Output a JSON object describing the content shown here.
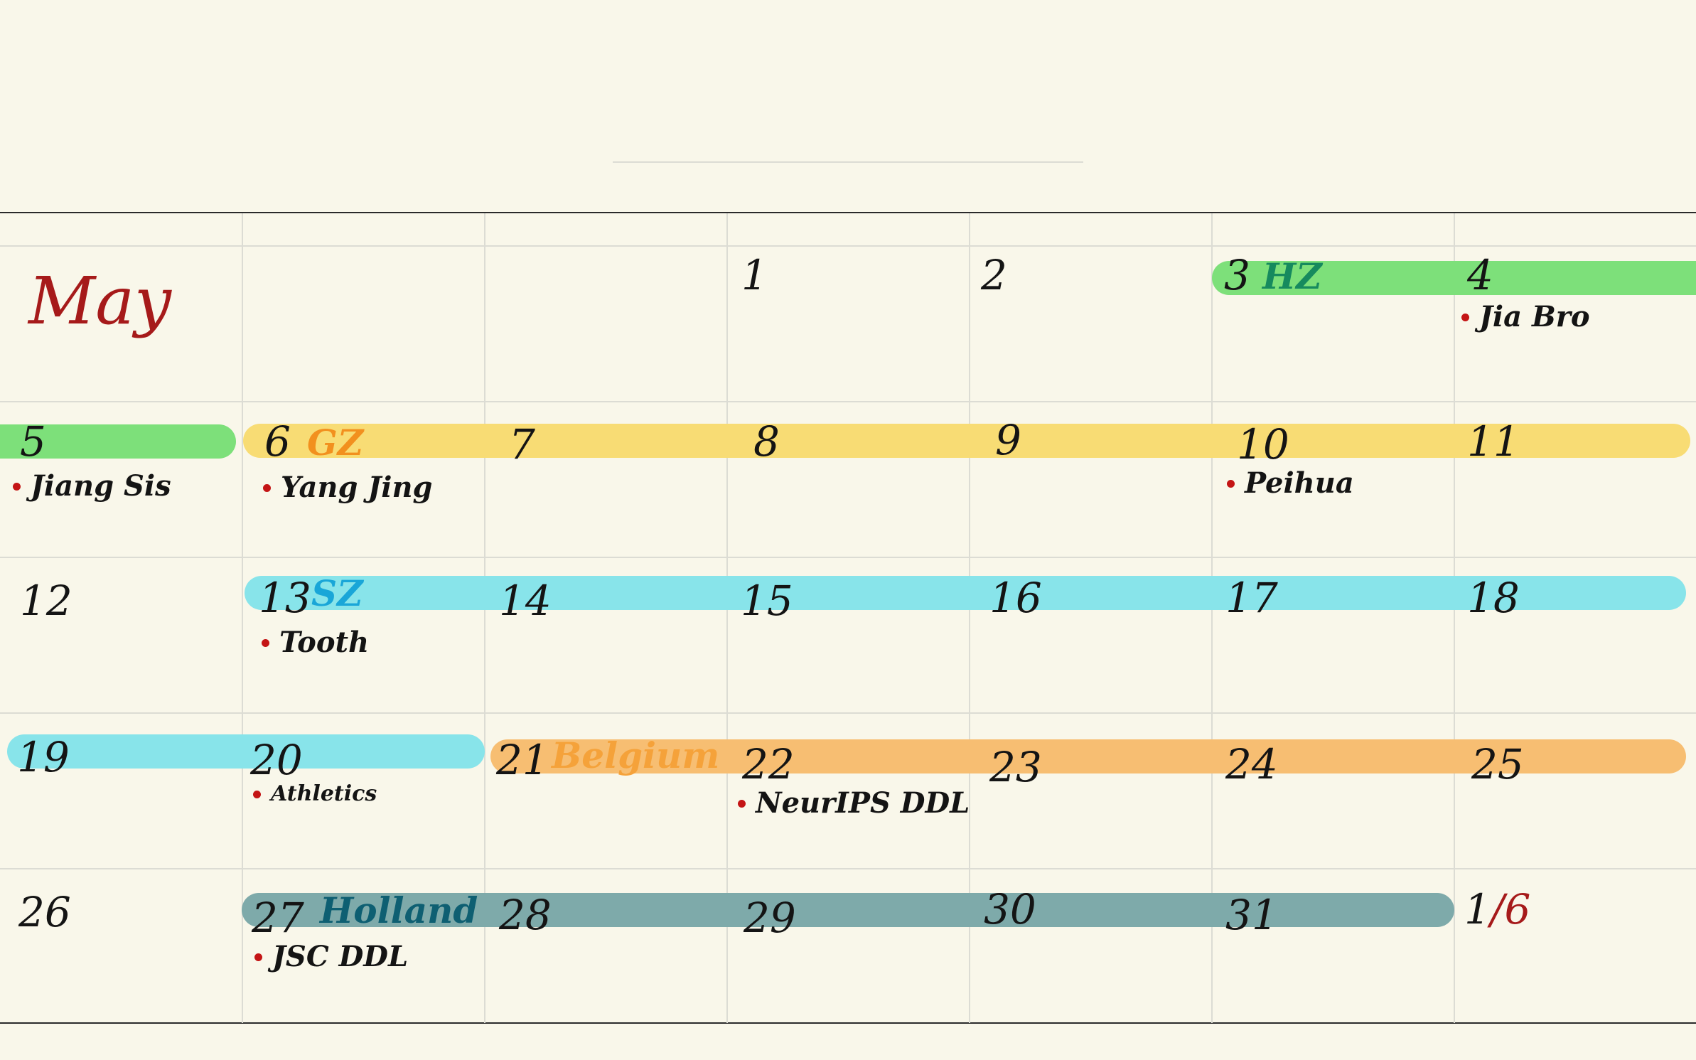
{
  "month": "May",
  "days": {
    "d1": "1",
    "d2": "2",
    "d3": "3",
    "d4": "4",
    "d5": "5",
    "d6": "6",
    "d7": "7",
    "d8": "8",
    "d9": "9",
    "d10": "10",
    "d11": "11",
    "d12": "12",
    "d13": "13",
    "d14": "14",
    "d15": "15",
    "d16": "16",
    "d17": "17",
    "d18": "18",
    "d19": "19",
    "d20": "20",
    "d21": "21",
    "d22": "22",
    "d23": "23",
    "d24": "24",
    "d25": "25",
    "d26": "26",
    "d27": "27",
    "d28": "28",
    "d29": "29",
    "d30": "30",
    "d31": "31",
    "june_first_month": "1",
    "june_first_sep": "/",
    "june_first_day": "6"
  },
  "trips": {
    "hz": "HZ",
    "gz": "GZ",
    "sz": "SZ",
    "belgium": "Belgium",
    "holland": "Holland"
  },
  "events": {
    "jia_bro": "Jia Bro",
    "jiang_sis": "Jiang Sis",
    "yang_jing": "Yang Jing",
    "peihua": "Peihua",
    "tooth": "Tooth",
    "athletics": "Athletics",
    "neurips_ddl": "NeurIPS DDL",
    "jsc_ddl": "JSC DDL"
  },
  "colors": {
    "hz_bar": "#7de07a",
    "gz_bar": "#f8dc74",
    "sz_bar": "#88e4ea",
    "belgium_bar": "#f7be72",
    "holland_bar": "#7eaaaa",
    "hz_text": "#168a5e",
    "gz_text": "#f2901e",
    "sz_text": "#19a6d8",
    "belgium_text": "#f5a23a",
    "holland_text": "#0e5f72",
    "month_text": "#a61a1a",
    "event_dot": "#c41515"
  }
}
